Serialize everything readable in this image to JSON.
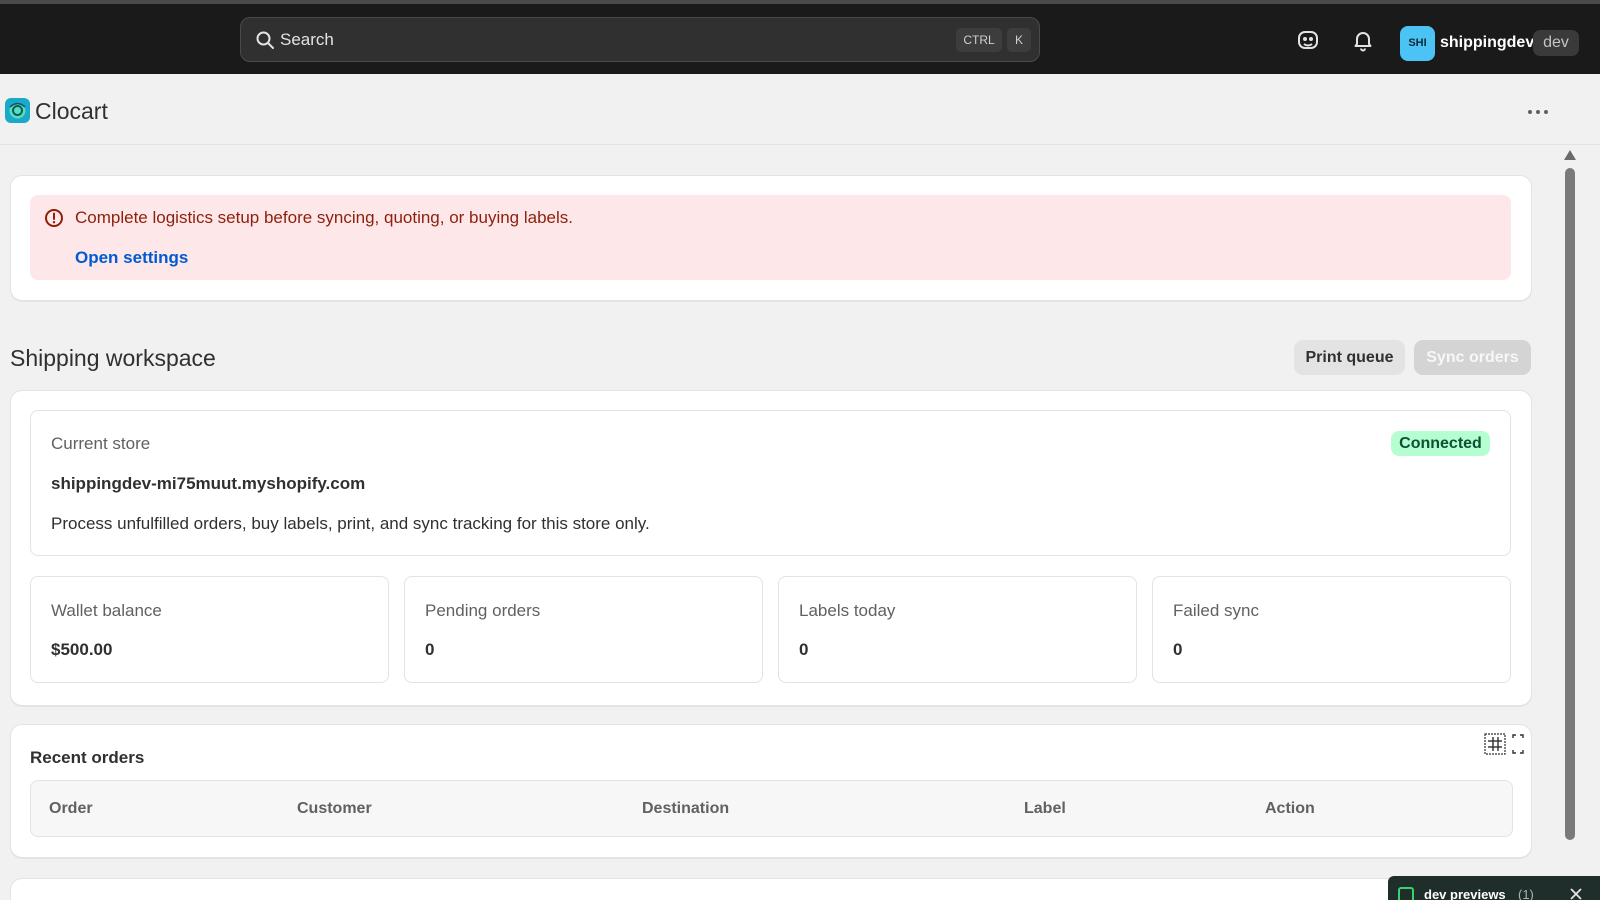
{
  "topbar": {
    "search_placeholder": "Search",
    "shortcut_ctrl": "CTRL",
    "shortcut_key": "K",
    "account": {
      "avatar_initials": "SHI",
      "name": "shippingdev",
      "badge": "dev"
    },
    "icons": [
      "search-icon",
      "devtools-icon",
      "bell-icon"
    ]
  },
  "app": {
    "title": "Clocart",
    "logo_icon": "clocart-logo"
  },
  "banner": {
    "message": "Complete logistics setup before syncing, quoting, or buying labels.",
    "link": "Open settings",
    "icon": "alert-circle-icon"
  },
  "workspace": {
    "title": "Shipping workspace",
    "print_queue_label": "Print queue",
    "sync_orders_label": "Sync orders",
    "store": {
      "label": "Current store",
      "domain": "shippingdev-mi75muut.myshopify.com",
      "description": "Process unfulfilled orders, buy labels, print, and sync tracking for this store only.",
      "status": "Connected"
    },
    "stats": [
      {
        "label": "Wallet balance",
        "value": "$500.00"
      },
      {
        "label": "Pending orders",
        "value": "0"
      },
      {
        "label": "Labels today",
        "value": "0"
      },
      {
        "label": "Failed sync",
        "value": "0"
      }
    ]
  },
  "orders": {
    "title": "Recent orders",
    "columns": [
      "Order",
      "Customer",
      "Destination",
      "Label",
      "Action"
    ]
  },
  "devbar": {
    "label": "dev previews",
    "count": "(1)"
  },
  "colors": {
    "topbar_bg": "#1a1a1a",
    "banner_bg": "#fde7e9",
    "banner_text": "#8e1f0b",
    "link": "#005bd3",
    "connected_bg": "#b4fed2"
  }
}
